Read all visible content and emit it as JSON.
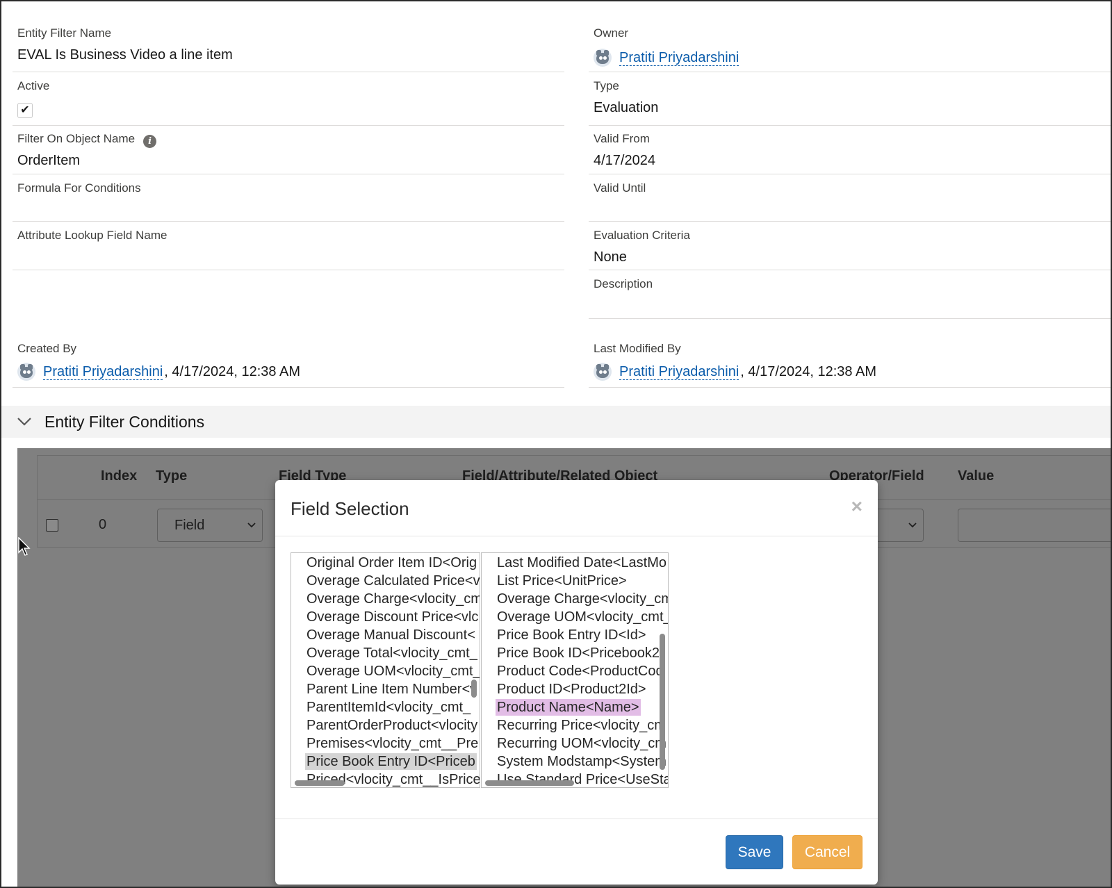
{
  "details": {
    "entity_filter_name": {
      "label": "Entity Filter Name",
      "value": "EVAL Is Business Video a line item"
    },
    "owner": {
      "label": "Owner",
      "user": "Pratiti Priyadarshini"
    },
    "active": {
      "label": "Active",
      "checked": true,
      "check_glyph": "✔"
    },
    "type": {
      "label": "Type",
      "value": "Evaluation"
    },
    "filter_on_object_name": {
      "label": "Filter On Object Name",
      "value": "OrderItem",
      "info_glyph": "i"
    },
    "valid_from": {
      "label": "Valid From",
      "value": "4/17/2024"
    },
    "formula_for_conditions": {
      "label": "Formula For Conditions",
      "value": ""
    },
    "valid_until": {
      "label": "Valid Until",
      "value": ""
    },
    "attribute_lookup_field_name": {
      "label": "Attribute Lookup Field Name",
      "value": ""
    },
    "evaluation_criteria": {
      "label": "Evaluation Criteria",
      "value": "None"
    },
    "description": {
      "label": "Description",
      "value": ""
    },
    "created_by": {
      "label": "Created By",
      "user": "Pratiti Priyadarshini",
      "timestamp": ", 4/17/2024, 12:38 AM"
    },
    "last_modified_by": {
      "label": "Last Modified By",
      "user": "Pratiti Priyadarshini",
      "timestamp": ", 4/17/2024, 12:38 AM"
    }
  },
  "section": {
    "title": "Entity Filter Conditions",
    "chevron": "⌄"
  },
  "conditions_table": {
    "headers": [
      "Index",
      "Type",
      "Field Type",
      "Field/Attribute/Related Object",
      "Operator/Field",
      "Value"
    ],
    "row": {
      "index": "0",
      "type": "Field"
    }
  },
  "modal": {
    "title": "Field Selection",
    "close_glyph": "×",
    "left_list": [
      "Original Order Item ID<Orig",
      "Overage Calculated Price<v",
      "Overage Charge<vlocity_cm",
      "Overage Discount Price<vlc",
      "Overage Manual Discount<",
      "Overage Total<vlocity_cmt_",
      "Overage UOM<vlocity_cmt_",
      "Parent Line Item Number<v",
      "ParentItemId<vlocity_cmt_",
      "ParentOrderProduct<vlocity",
      "Premises<vlocity_cmt__Pre",
      "Price Book Entry ID<Priceb",
      "Priced<vlocity_cmt__IsPrice"
    ],
    "left_selected": "Price Book Entry ID<Priceb",
    "right_list": [
      "Last Modified Date<LastMo",
      "List Price<UnitPrice>",
      "Overage Charge<vlocity_cm",
      "Overage UOM<vlocity_cmt_",
      "Price Book Entry ID<Id>",
      "Price Book ID<Pricebook2I",
      "Product Code<ProductCod",
      "Product ID<Product2Id>",
      "Product Name<Name>",
      "Recurring Price<vlocity_cm",
      "Recurring UOM<vlocity_cm",
      "System Modstamp<System",
      "Use Standard Price<UseSta"
    ],
    "right_selected": "Product Name<Name>",
    "save_label": "Save",
    "cancel_label": "Cancel"
  },
  "colors": {
    "link": "#0b5cab",
    "save_button": "#2f77bd",
    "cancel_button": "#f0ad4e",
    "overlay": "#808080",
    "right_selection": "#e2bde6",
    "left_selection": "#d4d4d4"
  }
}
